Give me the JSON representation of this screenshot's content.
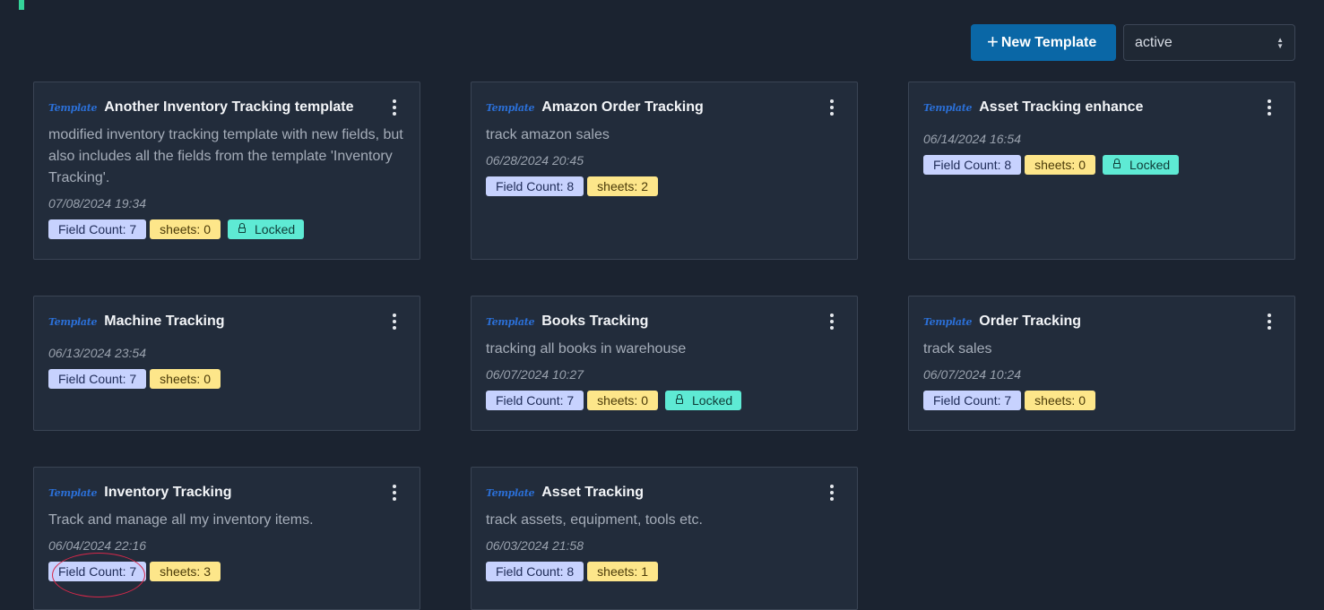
{
  "toolbar": {
    "new_template_label": "New Template",
    "status_value": "active"
  },
  "icons": {
    "plus": "plus-icon",
    "kebab": "kebab-menu-icon",
    "lock": "lock-icon",
    "select_chevron": "chevron-up-down-icon"
  },
  "colors": {
    "accent": "#34d399",
    "primary_button": "#0a67a6",
    "field_badge": "#c7d2fe",
    "sheets_badge": "#fde68a",
    "locked_badge": "#5eead4",
    "template_logo": "#2b6fd6",
    "annotation_ellipse": "#d6284a"
  },
  "templates": [
    {
      "logo": "Template",
      "title": "Another Inventory Tracking template",
      "description": "modified inventory tracking template with new fields, but also includes all the fields from the template 'Inventory Tracking'.",
      "date": "07/08/2024 19:34",
      "field_count": "Field Count: 7",
      "sheets": "sheets: 0",
      "locked": "Locked"
    },
    {
      "logo": "Template",
      "title": "Amazon Order Tracking",
      "description": "track amazon sales",
      "date": "06/28/2024 20:45",
      "field_count": "Field Count: 8",
      "sheets": "sheets: 2"
    },
    {
      "logo": "Template",
      "title": "Asset Tracking enhance",
      "description": "",
      "date": "06/14/2024 16:54",
      "field_count": "Field Count: 8",
      "sheets": "sheets: 0",
      "locked": "Locked"
    },
    {
      "logo": "Template",
      "title": "Machine Tracking",
      "description": "",
      "date": "06/13/2024 23:54",
      "field_count": "Field Count: 7",
      "sheets": "sheets: 0"
    },
    {
      "logo": "Template",
      "title": "Books Tracking",
      "description": "tracking all books in warehouse",
      "date": "06/07/2024 10:27",
      "field_count": "Field Count: 7",
      "sheets": "sheets: 0",
      "locked": "Locked"
    },
    {
      "logo": "Template",
      "title": "Order Tracking",
      "description": "track sales",
      "date": "06/07/2024 10:24",
      "field_count": "Field Count: 7",
      "sheets": "sheets: 0"
    },
    {
      "logo": "Template",
      "title": "Inventory Tracking",
      "description": "Track and manage all my inventory items.",
      "date": "06/04/2024 22:16",
      "field_count": "Field Count: 7",
      "sheets": "sheets: 3"
    },
    {
      "logo": "Template",
      "title": "Asset Tracking",
      "description": "track assets, equipment, tools etc.",
      "date": "06/03/2024 21:58",
      "field_count": "Field Count: 8",
      "sheets": "sheets: 1"
    }
  ]
}
